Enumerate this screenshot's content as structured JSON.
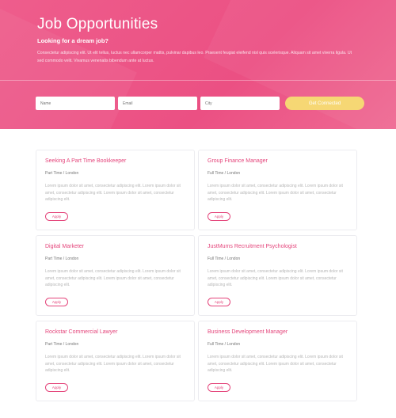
{
  "hero": {
    "title": "Job Opportunities",
    "subtitle": "Looking for a dream job?",
    "description": "Consectetur adipiscing elit. Ut elit tellus, luctus nec ullamcorper mattis, pulvinar dapibus leo. Praesent feugiat eleifend nisl quis scelerisque. Aliquam sit amet viverra ligula. Ut sed commodo velit. Vivamus venenatis bibendum ante at luctus."
  },
  "form": {
    "name_placeholder": "Name",
    "email_placeholder": "Email",
    "city_placeholder": "City",
    "submit_label": "Get Connected"
  },
  "jobs": [
    {
      "title": "Seeking A Part Time Bookkeeper",
      "meta": "Part Time / London",
      "desc": "Lorem ipsum dolor sit amet, consectetur adipiscing elit. Lorem ipsum dolor sit amet, consectetur adipiscing elit. Lorem ipsum dolor sit amet, consectetur adipiscing elit.",
      "apply": "Apply"
    },
    {
      "title": "Group Finance Manager",
      "meta": "Full Time / London",
      "desc": "Lorem ipsum dolor sit amet, consectetur adipiscing elit. Lorem ipsum dolor sit amet, consectetur adipiscing elit. Lorem ipsum dolor sit amet, consectetur adipiscing elit.",
      "apply": "Apply"
    },
    {
      "title": "Digital Marketer",
      "meta": "Part Time / London",
      "desc": "Lorem ipsum dolor sit amet, consectetur adipiscing elit. Lorem ipsum dolor sit amet, consectetur adipiscing elit. Lorem ipsum dolor sit amet, consectetur adipiscing elit.",
      "apply": "Apply"
    },
    {
      "title": "JustMums Recruitment Psychologist",
      "meta": "Full Time / London",
      "desc": "Lorem ipsum dolor sit amet, consectetur adipiscing elit. Lorem ipsum dolor sit amet, consectetur adipiscing elit. Lorem ipsum dolor sit amet, consectetur adipiscing elit.",
      "apply": "Apply"
    },
    {
      "title": "Rockstar Commercial Lawyer",
      "meta": "Part Time / London",
      "desc": "Lorem ipsum dolor sit amet, consectetur adipiscing elit. Lorem ipsum dolor sit amet, consectetur adipiscing elit. Lorem ipsum dolor sit amet, consectetur adipiscing elit.",
      "apply": "Apply"
    },
    {
      "title": "Business Development Manager",
      "meta": "Full Time / London",
      "desc": "Lorem ipsum dolor sit amet, consectetur adipiscing elit. Lorem ipsum dolor sit amet, consectetur adipiscing elit. Lorem ipsum dolor sit amet, consectetur adipiscing elit.",
      "apply": "Apply"
    }
  ],
  "colors": {
    "accent": "#e4457b",
    "hero_bg": "#eb5083",
    "button": "#f6d774"
  }
}
